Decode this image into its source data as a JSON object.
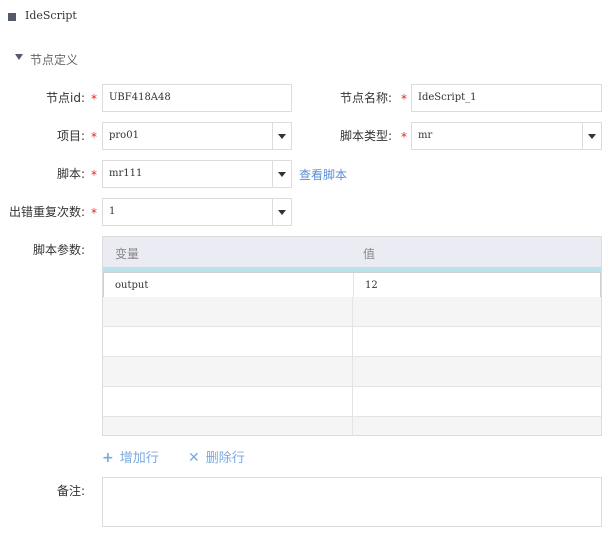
{
  "header": {
    "title": "IdeScript"
  },
  "section": {
    "title": "节点定义"
  },
  "form": {
    "node_id": {
      "label": "节点id:",
      "value": "UBF418A48"
    },
    "node_name": {
      "label": "节点名称:",
      "value": "IdeScript_1"
    },
    "project": {
      "label": "项目:",
      "value": "pro01"
    },
    "script_type": {
      "label": "脚本类型:",
      "value": "mr"
    },
    "script": {
      "label": "脚本:",
      "value": "mr111",
      "link": "查看脚本"
    },
    "retry": {
      "label": "出错重复次数:",
      "value": "1"
    },
    "required_mark": "*"
  },
  "params": {
    "label": "脚本参数:",
    "columns": [
      "变量",
      "值"
    ],
    "rows": [
      {
        "var": "output",
        "val": "12"
      }
    ],
    "add_row": "增加行",
    "delete_row": "删除行"
  },
  "remark": {
    "label": "备注:",
    "value": ""
  },
  "colors": {
    "required": "#e02828",
    "link": "#5b8ed6",
    "grid_header": "#ebebf3",
    "grid_accent": "#b8e3ea"
  }
}
